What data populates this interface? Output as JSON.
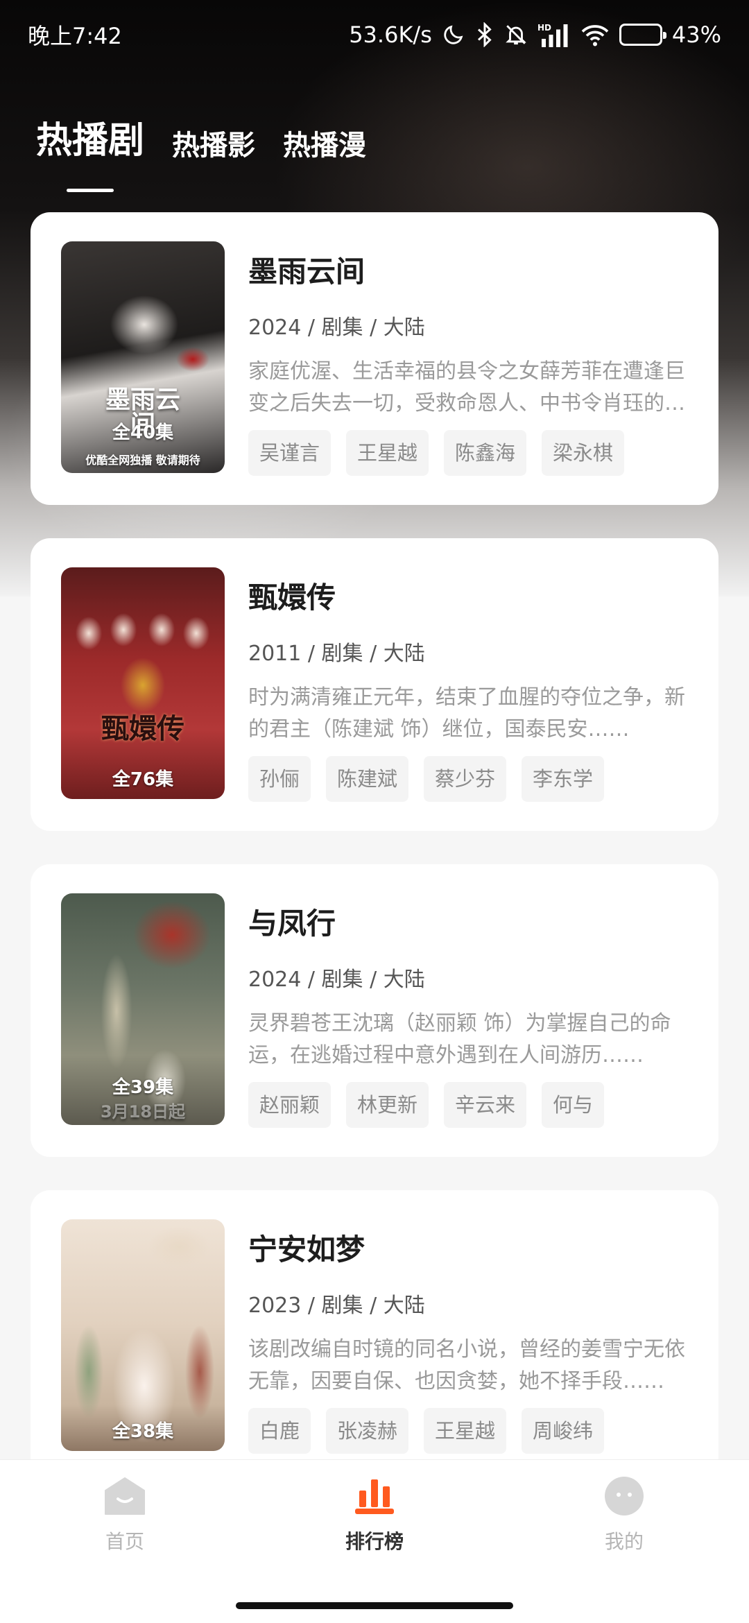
{
  "status_bar": {
    "time": "晚上7:42",
    "network_speed": "53.6K/s",
    "battery_percent": "43%",
    "battery_level": 0.43,
    "icons": [
      "moon-icon",
      "bluetooth-icon",
      "bell-off-icon",
      "signal-hd-icon",
      "wifi-icon",
      "battery-icon"
    ]
  },
  "tabs": [
    {
      "label": "热播剧",
      "active": true
    },
    {
      "label": "热播影",
      "active": false
    },
    {
      "label": "热播漫",
      "active": false
    }
  ],
  "shows": [
    {
      "title": "墨雨云间",
      "meta": "2024 / 剧集 / 大陆",
      "description": "家庭优渥、生活幸福的县令之女薛芳菲在遭逢巨变之后失去一切，受救命恩人、中书令肖珏的帮助重获新生……",
      "episodes": "全40集",
      "poster_text": "墨雨云间",
      "poster_caption": "优酷全网独播 敬请期待",
      "actors": [
        "吴谨言",
        "王星越",
        "陈鑫海",
        "梁永棋"
      ]
    },
    {
      "title": "甄嬛传",
      "meta": "2011 / 剧集 / 大陆",
      "description": "时为满清雍正元年，结束了血腥的夺位之争，新的君主（陈建斌 饰）继位，国泰民安……",
      "episodes": "全76集",
      "poster_text": "甄嬛传",
      "actors": [
        "孙俪",
        "陈建斌",
        "蔡少芬",
        "李东学"
      ]
    },
    {
      "title": "与凤行",
      "meta": "2024 / 剧集 / 大陆",
      "description": "灵界碧苍王沈璃（赵丽颖 饰）为掌握自己的命运，在逃婚过程中意外遇到在人间游历……",
      "episodes": "全39集",
      "poster_caption": "3月18日起",
      "actors": [
        "赵丽颖",
        "林更新",
        "辛云来",
        "何与"
      ]
    },
    {
      "title": "宁安如梦",
      "meta": "2023 / 剧集 / 大陆",
      "description": "该剧改编自时镜的同名小说，曾经的姜雪宁无依无靠，因要自保、也因贪婪，她不择手段……",
      "episodes": "全38集",
      "actors": [
        "白鹿",
        "张凌赫",
        "王星越",
        "周峻纬"
      ]
    }
  ],
  "bottom_nav": [
    {
      "label": "首页",
      "icon": "home-icon",
      "active": false
    },
    {
      "label": "排行榜",
      "icon": "ranking-icon",
      "active": true
    },
    {
      "label": "我的",
      "icon": "profile-icon",
      "active": false
    }
  ],
  "colors": {
    "accent": "#ff5a1f",
    "inactive_icon": "#d6d6d6"
  }
}
